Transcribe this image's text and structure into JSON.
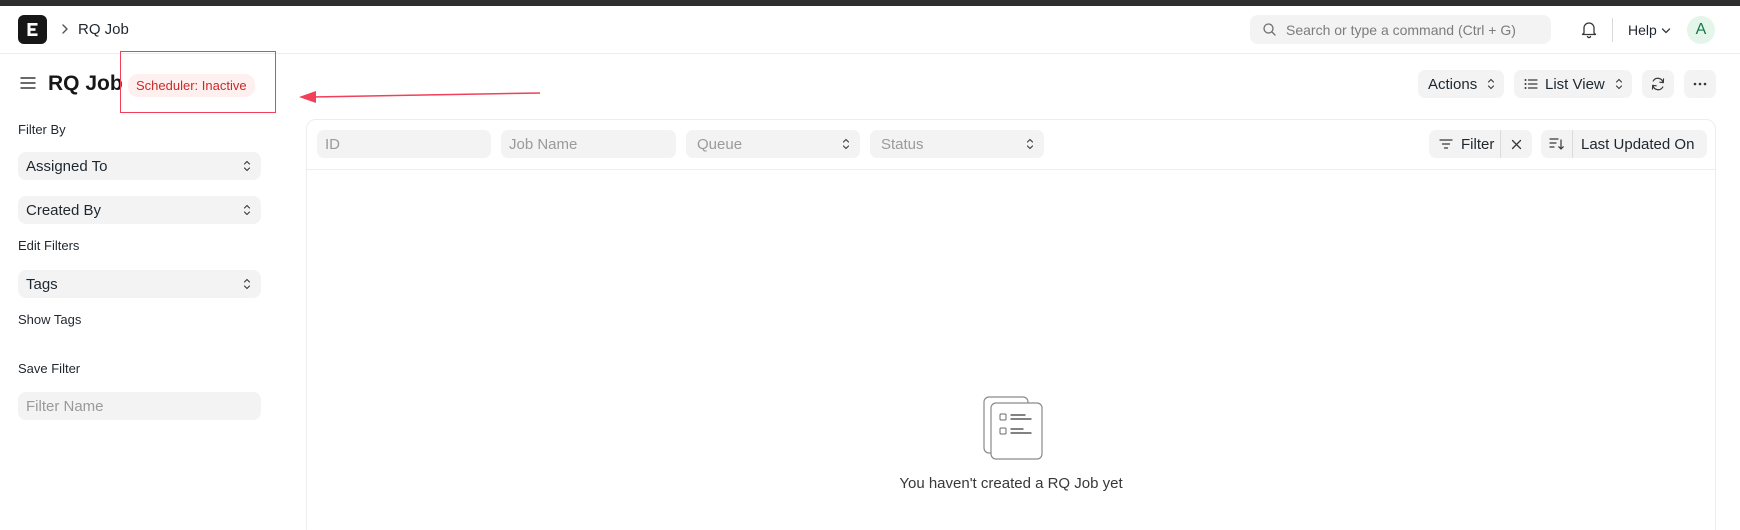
{
  "navbar": {
    "breadcrumb": "RQ Job",
    "search_placeholder": "Search or type a command (Ctrl + G)",
    "help_label": "Help",
    "avatar_initial": "A"
  },
  "page": {
    "title": "RQ Job",
    "status_badge": "Scheduler: Inactive",
    "actions_label": "Actions",
    "list_view_label": "List View"
  },
  "sidebar": {
    "filter_by_label": "Filter By",
    "assigned_to_label": "Assigned To",
    "created_by_label": "Created By",
    "edit_filters_label": "Edit Filters",
    "tags_label": "Tags",
    "show_tags_label": "Show Tags",
    "save_filter_label": "Save Filter",
    "filter_name_placeholder": "Filter Name"
  },
  "list": {
    "filters": {
      "id_placeholder": "ID",
      "job_name_placeholder": "Job Name",
      "queue_label": "Queue",
      "status_label": "Status"
    },
    "filter_button_label": "Filter",
    "sort_label": "Last Updated On",
    "empty_message": "You haven't created a RQ Job yet"
  },
  "colors": {
    "badge_text": "#cc2929",
    "badge_bg": "#fff0f0",
    "annotation": "#f0405a",
    "avatar_text": "#16794c",
    "avatar_bg": "#e4f5e9"
  }
}
